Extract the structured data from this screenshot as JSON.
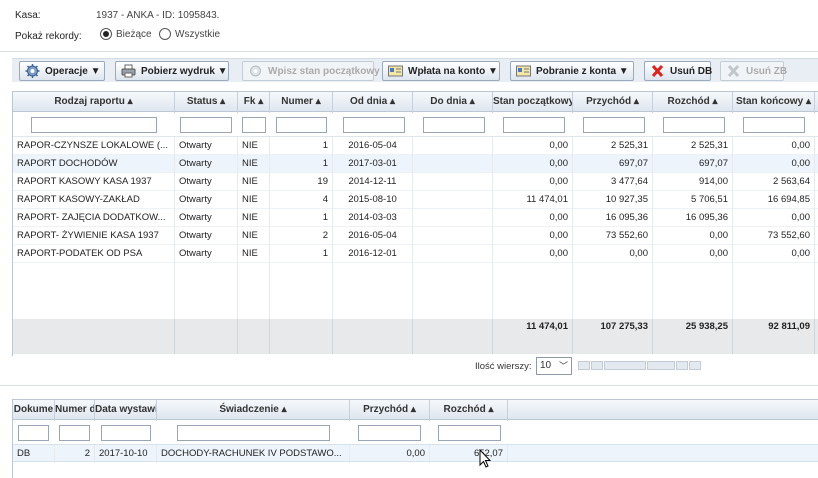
{
  "header": {
    "kasa_label": "Kasa:",
    "kasa_value": "1937 - ANKA - ID: 1095843.",
    "records_label": "Pokaż rekordy:",
    "radio_current": "Bieżące",
    "radio_all": "Wszystkie",
    "selected": "current"
  },
  "toolbar": {
    "operations": "Operacje ▼",
    "print": "Pobierz wydruk ▼",
    "initial_state": "Wpisz stan początkowy",
    "deposit": "Wpłata na konto ▼",
    "withdraw": "Pobranie z konta ▼",
    "delete_db": "Usuń DB",
    "delete_zb": "Usuń ZB"
  },
  "reports": {
    "columns": [
      "Rodzaj raportu",
      "Status",
      "Fk",
      "Numer",
      "Od dnia",
      "Do dnia",
      "Stan początkowy",
      "Przychód",
      "Rozchód",
      "Stan końcowy"
    ],
    "rows": [
      [
        "RAPOR-CZYNSZE LOKALOWE (...",
        "Otwarty",
        "NIE",
        "1",
        "2016-05-04",
        "",
        "0,00",
        "2 525,31",
        "2 525,31",
        "0,00"
      ],
      [
        "RAPORT DOCHODÓW",
        "Otwarty",
        "NIE",
        "1",
        "2017-03-01",
        "",
        "0,00",
        "697,07",
        "697,07",
        "0,00"
      ],
      [
        "RAPORT KASOWY KASA 1937",
        "Otwarty",
        "NIE",
        "19",
        "2014-12-11",
        "",
        "0,00",
        "3 477,64",
        "914,00",
        "2 563,64"
      ],
      [
        "RAPORT KASOWY-ZAKŁAD",
        "Otwarty",
        "NIE",
        "4",
        "2015-08-10",
        "",
        "11 474,01",
        "10 927,35",
        "5 706,51",
        "16 694,85"
      ],
      [
        "RAPORT- ZAJĘCIA DODATKOW...",
        "Otwarty",
        "NIE",
        "1",
        "2014-03-03",
        "",
        "0,00",
        "16 095,36",
        "16 095,36",
        "0,00"
      ],
      [
        "RAPORT- ŻYWIENIE KASA 1937",
        "Otwarty",
        "NIE",
        "2",
        "2016-05-04",
        "",
        "0,00",
        "73 552,60",
        "0,00",
        "73 552,60"
      ],
      [
        "RAPORT-PODATEK OD PSA",
        "Otwarty",
        "NIE",
        "1",
        "2016-12-01",
        "",
        "0,00",
        "0,00",
        "0,00",
        "0,00"
      ]
    ],
    "totals": [
      "11 474,01",
      "107 275,33",
      "25 938,25",
      "92 811,09"
    ],
    "rows_label": "Ilość wierszy:",
    "rows_value": "10"
  },
  "documents": {
    "columns": [
      "Dokume",
      "Numer d",
      "Data wystawie",
      "Świadczenie",
      "Przychód",
      "Rozchód"
    ],
    "rows": [
      [
        "DB",
        "2",
        "2017-10-10",
        "DOCHODY-RACHUNEK IV PODSTAWO...",
        "0,00",
        "652,07"
      ]
    ]
  },
  "colors": {
    "header_bg": "#dfe6ee",
    "selected_row": "#eef4fb",
    "summary_bg": "#e7e9eb",
    "delete_red": "#d9261c"
  }
}
